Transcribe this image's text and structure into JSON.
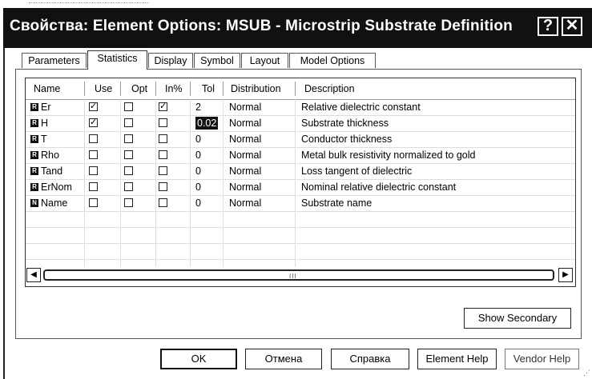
{
  "window": {
    "title": "Свойства: Element Options: MSUB - Microstrip Substrate Definition",
    "help_glyph": "?",
    "close_glyph": "✕"
  },
  "tabs": [
    {
      "label": "Parameters",
      "active": false
    },
    {
      "label": "Statistics",
      "active": true
    },
    {
      "label": "Display",
      "active": false
    },
    {
      "label": "Symbol",
      "active": false
    },
    {
      "label": "Layout",
      "active": false
    },
    {
      "label": "Model Options",
      "active": false
    }
  ],
  "grid": {
    "columns": [
      "Name",
      "Use",
      "Opt",
      "In%",
      "Tol",
      "Distribution",
      "Description"
    ],
    "rows": [
      {
        "badge": "R",
        "name": "Er",
        "use": true,
        "opt": false,
        "inpct": true,
        "tol": "2",
        "dist": "Normal",
        "desc": "Relative dielectric constant"
      },
      {
        "badge": "R",
        "name": "H",
        "use": true,
        "opt": false,
        "inpct": false,
        "tol": "0.02",
        "dist": "Normal",
        "desc": "Substrate thickness"
      },
      {
        "badge": "R",
        "name": "T",
        "use": false,
        "opt": false,
        "inpct": false,
        "tol": "0",
        "dist": "Normal",
        "desc": "Conductor thickness"
      },
      {
        "badge": "R",
        "name": "Rho",
        "use": false,
        "opt": false,
        "inpct": false,
        "tol": "0",
        "dist": "Normal",
        "desc": "Metal bulk resistivity normalized to gold"
      },
      {
        "badge": "R",
        "name": "Tand",
        "use": false,
        "opt": false,
        "inpct": false,
        "tol": "0",
        "dist": "Normal",
        "desc": "Loss tangent of dielectric"
      },
      {
        "badge": "R",
        "name": "ErNom",
        "use": false,
        "opt": false,
        "inpct": false,
        "tol": "0",
        "dist": "Normal",
        "desc": "Nominal relative dielectric constant"
      },
      {
        "badge": "N",
        "name": "Name",
        "use": false,
        "opt": false,
        "inpct": false,
        "tol": "0",
        "dist": "Normal",
        "desc": "Substrate name"
      }
    ],
    "scroll_left": "◀",
    "scroll_right": "▶",
    "scroll_grip": "III"
  },
  "buttons": {
    "show_secondary": "Show Secondary",
    "ok": "OK",
    "cancel": "Отмена",
    "help": "Справка",
    "element_help": "Element Help",
    "vendor_help": "Vendor Help"
  }
}
